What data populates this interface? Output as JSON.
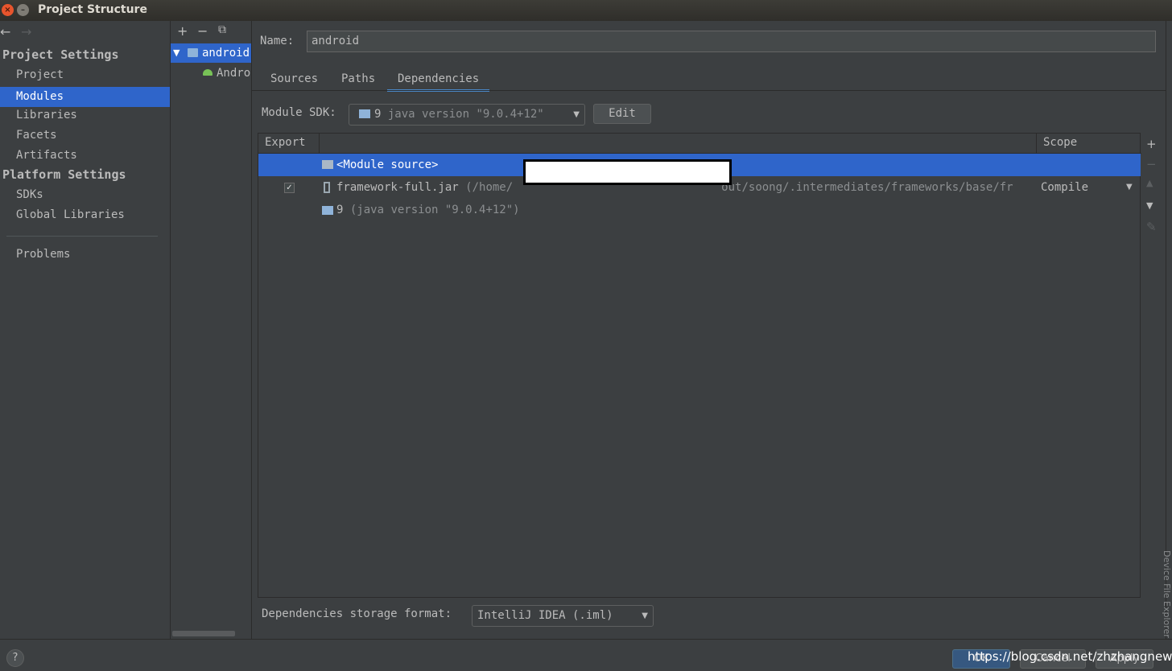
{
  "window": {
    "title": "Project Structure"
  },
  "nav": {
    "back_icon": "←",
    "forward_icon": "→",
    "project_settings_heading": "Project Settings",
    "project_items": [
      "Project",
      "Modules",
      "Libraries",
      "Facets",
      "Artifacts"
    ],
    "platform_settings_heading": "Platform Settings",
    "platform_items": [
      "SDKs",
      "Global Libraries"
    ],
    "problems": "Problems",
    "selected": "Modules"
  },
  "tree": {
    "toolbar": {
      "add": "+",
      "remove": "−",
      "copy": "⧉"
    },
    "module": "android",
    "facet": "Android"
  },
  "module": {
    "name_label": "Name:",
    "name_value": "android",
    "tabs": [
      "Sources",
      "Paths",
      "Dependencies"
    ],
    "active_tab": "Dependencies",
    "sdk_label": "Module SDK:",
    "sdk_value_num": "9",
    "sdk_value_desc": "java version \"9.0.4+12\"",
    "edit_label": "Edit"
  },
  "dependencies": {
    "col_export": "Export",
    "col_scope": "Scope",
    "rows": [
      {
        "name": "<Module source>",
        "detail": "",
        "scope": "",
        "export": false,
        "selected": true
      },
      {
        "name": "framework-full.jar",
        "detail_start": "(/home/",
        "detail_end": "out/soong/.intermediates/frameworks/base/fr",
        "scope": "Compile",
        "export": true,
        "selected": false
      },
      {
        "name": "9",
        "detail": "(java version \"9.0.4+12\")",
        "scope": "",
        "export": false,
        "selected": false
      }
    ],
    "storage_label": "Dependencies storage format:",
    "storage_value": "IntelliJ IDEA (.iml)"
  },
  "side_tool": "Device File Explorer",
  "footer": {
    "help": "?",
    "ok": "OK",
    "cancel": "Cancel",
    "apply": "Apply",
    "watermark": "https://blog.csdn.net/zhzhangnews"
  },
  "colors": {
    "selection": "#2f65ca",
    "background": "#3c3f41",
    "text": "#bbbbbb"
  }
}
